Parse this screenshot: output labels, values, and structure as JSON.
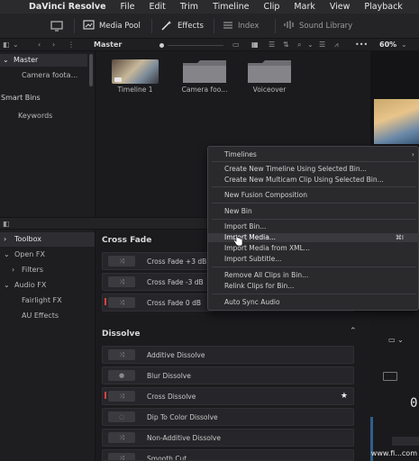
{
  "menubar": {
    "app_name": "DaVinci Resolve",
    "items": [
      "File",
      "Edit",
      "Trim",
      "Timeline",
      "Clip",
      "Mark",
      "View",
      "Playback"
    ]
  },
  "toolbar": {
    "media_pool": "Media Pool",
    "effects": "Effects",
    "index": "Index",
    "sound_library": "Sound Library"
  },
  "subbar": {
    "panel_title": "Master",
    "zoom": "60%"
  },
  "bins": {
    "master": "Master",
    "camera_footage": "Camera foota...",
    "smart_bins": "Smart Bins",
    "keywords": "Keywords"
  },
  "media": [
    {
      "label": "Timeline 1",
      "type": "timeline"
    },
    {
      "label": "Camera foo...",
      "type": "folder"
    },
    {
      "label": "Voiceover",
      "type": "folder"
    }
  ],
  "effects_tree": {
    "toolbox": "Toolbox",
    "open_fx": "Open FX",
    "filters": "Filters",
    "audio_fx": "Audio FX",
    "fairlight_fx": "Fairlight FX",
    "au_effects": "AU Effects"
  },
  "cross_fade": {
    "header": "Cross Fade",
    "items": [
      "Cross Fade +3 dB",
      "Cross Fade -3 dB",
      "Cross Fade 0 dB"
    ]
  },
  "dissolve": {
    "header": "Dissolve",
    "items": [
      "Additive Dissolve",
      "Blur Dissolve",
      "Cross Dissolve",
      "Dip To Color Dissolve",
      "Non-Additive Dissolve",
      "Smooth Cut"
    ]
  },
  "context_menu": {
    "timelines": "Timelines",
    "create_timeline": "Create New Timeline Using Selected Bin...",
    "create_multicam": "Create New Multicam Clip Using Selected Bin...",
    "new_fusion": "New Fusion Composition",
    "new_bin": "New Bin",
    "import_bin": "Import Bin...",
    "import_media": "Import Media...",
    "import_media_shortcut": "⌘I",
    "import_xml": "Import Media from XML...",
    "import_subtitle": "Import Subtitle...",
    "remove_clips": "Remove All Clips in Bin...",
    "relink_clips": "Relink Clips for Bin...",
    "auto_sync": "Auto Sync Audio"
  },
  "viewer": {
    "timecode": "0"
  },
  "watermark": "www.fi...com"
}
